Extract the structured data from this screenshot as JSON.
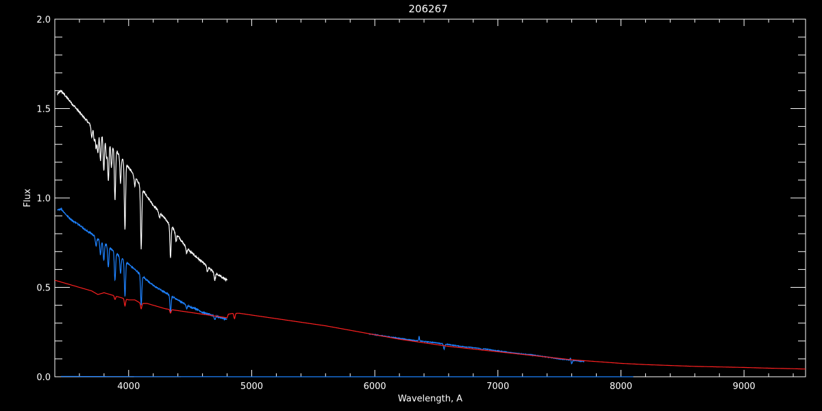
{
  "chart_data": {
    "type": "line",
    "title": "206267",
    "xlabel": "Wavelength, A",
    "ylabel": "Flux",
    "xlim": [
      3400,
      9500
    ],
    "ylim": [
      0.0,
      2.0
    ],
    "xticks": [
      4000,
      5000,
      6000,
      7000,
      8000,
      9000
    ],
    "yticks": [
      0.0,
      0.5,
      1.0,
      1.5,
      2.0
    ],
    "ytick_labels": [
      "0.0",
      "0.5",
      "1.0",
      "1.5",
      "2.0"
    ],
    "xminor_step": 200,
    "yminor_step": 0.1,
    "grid": false,
    "colors": {
      "background": "#000000",
      "axes": "#ffffff"
    },
    "series": [
      {
        "color": "#ffffff",
        "noise": 0.012,
        "x": [
          3420,
          3450,
          3500,
          3550,
          3600,
          3650,
          3700,
          3750,
          3800,
          3850,
          3900,
          3950,
          4000,
          4050,
          4100,
          4150,
          4200,
          4250,
          4300,
          4350,
          4400,
          4450,
          4500,
          4550,
          4600,
          4650,
          4700,
          4750,
          4800
        ],
        "y": [
          1.58,
          1.6,
          1.56,
          1.52,
          1.48,
          1.44,
          1.4,
          1.37,
          1.34,
          1.3,
          1.26,
          1.22,
          1.17,
          1.12,
          1.06,
          1.01,
          0.96,
          0.92,
          0.88,
          0.84,
          0.79,
          0.74,
          0.7,
          0.67,
          0.64,
          0.61,
          0.58,
          0.56,
          0.54
        ],
        "absorption_lines": [
          {
            "x": 3700,
            "depth": 0.06
          },
          {
            "x": 3720,
            "depth": 0.07
          },
          {
            "x": 3735,
            "depth": 0.1
          },
          {
            "x": 3750,
            "depth": 0.12
          },
          {
            "x": 3771,
            "depth": 0.15
          },
          {
            "x": 3798,
            "depth": 0.19
          },
          {
            "x": 3820,
            "depth": 0.1
          },
          {
            "x": 3835,
            "depth": 0.22
          },
          {
            "x": 3860,
            "depth": 0.12
          },
          {
            "x": 3889,
            "depth": 0.28
          },
          {
            "x": 3934,
            "depth": 0.15
          },
          {
            "x": 3970,
            "depth": 0.38
          },
          {
            "x": 4050,
            "depth": 0.05
          },
          {
            "x": 4102,
            "depth": 0.34
          },
          {
            "x": 4250,
            "depth": 0.03
          },
          {
            "x": 4340,
            "depth": 0.18
          },
          {
            "x": 4385,
            "depth": 0.05
          },
          {
            "x": 4471,
            "depth": 0.03
          },
          {
            "x": 4640,
            "depth": 0.03
          },
          {
            "x": 4700,
            "depth": 0.04
          }
        ]
      },
      {
        "color": "#1e82ff",
        "noise": 0.008,
        "x": [
          3420,
          3450,
          3500,
          3550,
          3600,
          3650,
          3700,
          3750,
          3800,
          3850,
          3900,
          3950,
          4000,
          4050,
          4100,
          4150,
          4200,
          4250,
          4300,
          4350,
          4400,
          4450,
          4500,
          4550,
          4600,
          4650,
          4700,
          4750,
          4800
        ],
        "y": [
          0.93,
          0.94,
          0.9,
          0.87,
          0.85,
          0.82,
          0.8,
          0.77,
          0.75,
          0.72,
          0.69,
          0.66,
          0.63,
          0.6,
          0.57,
          0.54,
          0.51,
          0.49,
          0.47,
          0.45,
          0.43,
          0.41,
          0.39,
          0.38,
          0.36,
          0.35,
          0.34,
          0.33,
          0.32
        ],
        "absorption_lines": [
          {
            "x": 3735,
            "depth": 0.05
          },
          {
            "x": 3771,
            "depth": 0.08
          },
          {
            "x": 3798,
            "depth": 0.1
          },
          {
            "x": 3835,
            "depth": 0.12
          },
          {
            "x": 3889,
            "depth": 0.16
          },
          {
            "x": 3934,
            "depth": 0.09
          },
          {
            "x": 3970,
            "depth": 0.2
          },
          {
            "x": 4102,
            "depth": 0.17
          },
          {
            "x": 4340,
            "depth": 0.09
          },
          {
            "x": 4471,
            "depth": 0.02
          },
          {
            "x": 4700,
            "depth": 0.02
          }
        ]
      },
      {
        "color": "#1e82ff",
        "noise": 0.004,
        "x": [
          5950,
          6100,
          6300,
          6500,
          6700,
          6900,
          7100,
          7300,
          7500,
          7700
        ],
        "y": [
          0.24,
          0.225,
          0.205,
          0.19,
          0.17,
          0.155,
          0.135,
          0.12,
          0.1,
          0.085
        ],
        "absorption_lines": [
          {
            "x": 6563,
            "depth": 0.03
          },
          {
            "x": 6870,
            "depth": 0.008
          },
          {
            "x": 7600,
            "depth": 0.02
          }
        ],
        "emission_lines": [
          {
            "x": 6360,
            "height": 0.025
          },
          {
            "x": 7590,
            "height": 0.015
          }
        ]
      },
      {
        "color": "#1e82ff",
        "noise": 0.0,
        "x": [
          3450,
          4000,
          5000,
          6000,
          7000,
          8000,
          8100
        ],
        "y": [
          0.002,
          0.001,
          0.0,
          0.0,
          0.0,
          0.0,
          0.0
        ]
      },
      {
        "color": "#ff2020",
        "noise": 0.0,
        "x": [
          3400,
          3500,
          3600,
          3700,
          3750,
          3800,
          3850,
          3900,
          3950,
          4000,
          4050,
          4100,
          4150,
          4200,
          4300,
          4400,
          4500,
          4600,
          4700,
          4800,
          4810,
          4850,
          4900,
          5000,
          5200,
          5400,
          5600,
          5800,
          6000,
          6200,
          6400,
          6600,
          6800,
          7000,
          7200,
          7400,
          7600,
          7800,
          8000,
          8200,
          8400,
          8600,
          8800,
          9000,
          9200,
          9400,
          9500
        ],
        "y": [
          0.54,
          0.52,
          0.5,
          0.48,
          0.46,
          0.47,
          0.46,
          0.45,
          0.44,
          0.43,
          0.43,
          0.41,
          0.41,
          0.4,
          0.38,
          0.37,
          0.36,
          0.35,
          0.34,
          0.33,
          0.35,
          0.355,
          0.355,
          0.345,
          0.325,
          0.305,
          0.285,
          0.26,
          0.235,
          0.21,
          0.19,
          0.17,
          0.155,
          0.14,
          0.125,
          0.11,
          0.095,
          0.085,
          0.075,
          0.068,
          0.063,
          0.058,
          0.055,
          0.052,
          0.048,
          0.045,
          0.043
        ],
        "absorption_lines": [
          {
            "x": 3889,
            "depth": 0.02
          },
          {
            "x": 3970,
            "depth": 0.04
          },
          {
            "x": 4102,
            "depth": 0.03
          },
          {
            "x": 4340,
            "depth": 0.02
          },
          {
            "x": 4860,
            "depth": 0.03
          }
        ]
      }
    ]
  }
}
